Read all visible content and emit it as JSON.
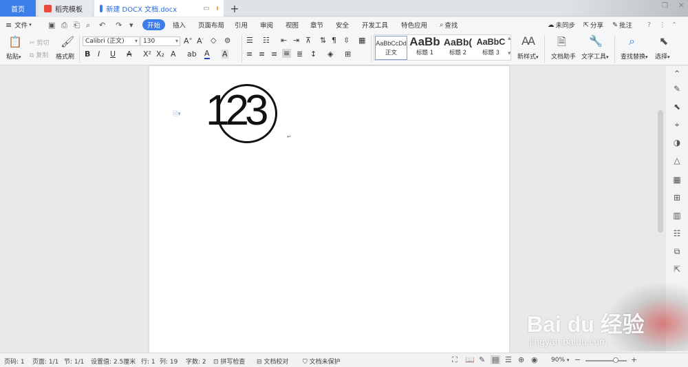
{
  "tabs": {
    "home": "首页",
    "templates": "稻壳模板",
    "document": "新建 DOCX 文档.docx",
    "new_tab": "+"
  },
  "menu": {
    "file": "文件",
    "items": [
      "开始",
      "插入",
      "页面布局",
      "引用",
      "审阅",
      "视图",
      "章节",
      "安全",
      "开发工具",
      "特色应用"
    ],
    "search": "查找",
    "sync": "未同步",
    "share": "分享",
    "comment": "批注",
    "help": "?"
  },
  "ribbon": {
    "paste": "粘贴",
    "cut": "剪切",
    "copy": "复制",
    "format_painter": "格式刷",
    "font_name": "Calibri (正文)",
    "font_size": "130",
    "styles": [
      {
        "sample": "AaBbCcDd",
        "caption": "正文"
      },
      {
        "sample": "AaBb",
        "caption": "标题 1"
      },
      {
        "sample": "AaBb(",
        "caption": "标题 2"
      },
      {
        "sample": "AaBbC",
        "caption": "标题 3"
      }
    ],
    "new_style": "新样式",
    "doc_assistant": "文档助手",
    "text_tools": "文字工具",
    "find_replace": "查找替换",
    "select": "选择"
  },
  "document": {
    "enclosed_text": "123"
  },
  "status": {
    "page_code": "页码: 1",
    "pages": "页面: 1/1",
    "section": "节: 1/1",
    "setting": "设置值: 2.5厘米",
    "row": "行: 1",
    "col": "列: 19",
    "word_count": "字数: 2",
    "spell_check": "拼写检查",
    "doc_proof": "文档校对",
    "doc_protect": "文档未保护",
    "zoom": "90%"
  },
  "watermark": {
    "main": "Bai du 经验",
    "sub": "jingyan.baidu.com"
  }
}
